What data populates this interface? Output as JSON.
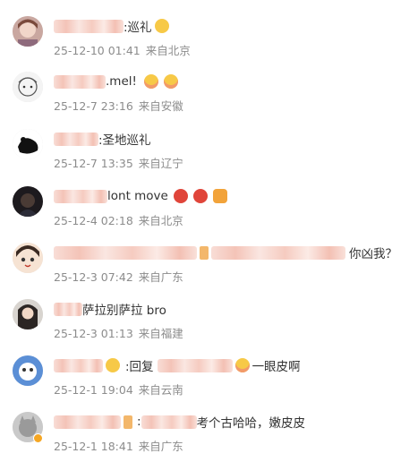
{
  "comments": [
    {
      "text_suffix": ":巡礼",
      "timestamp": "25-12-10 01:41",
      "location": "来自北京"
    },
    {
      "text_suffix": ".mel!",
      "timestamp": "25-12-7 23:16",
      "location": "来自安徽"
    },
    {
      "text_suffix": ":圣地巡礼",
      "timestamp": "25-12-7 13:35",
      "location": "来自辽宁"
    },
    {
      "text_suffix": "lont move",
      "timestamp": "25-12-4 02:18",
      "location": "来自北京"
    },
    {
      "text_suffix": "你凶我？",
      "timestamp": "25-12-3 07:42",
      "location": "来自广东"
    },
    {
      "text_suffix": "萨拉别萨拉 bro",
      "timestamp": "25-12-3 01:13",
      "location": "来自福建"
    },
    {
      "reply_label": ":回复",
      "text_suffix": "一眼皮啊",
      "timestamp": "25-12-1 19:04",
      "location": "来自云南"
    },
    {
      "text_suffix": "考个古哈哈，嫩皮皮",
      "timestamp": "25-12-1 18:41",
      "location": "来自广东"
    }
  ]
}
